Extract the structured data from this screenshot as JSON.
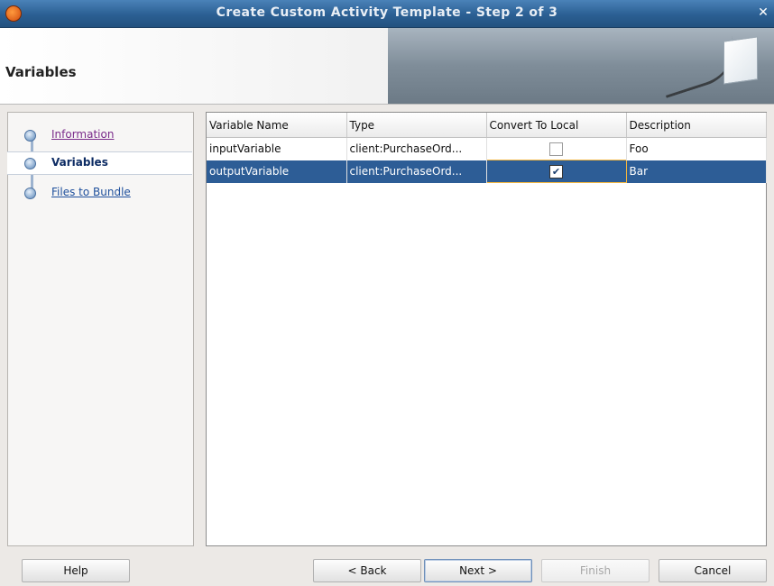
{
  "window": {
    "title": "Create Custom Activity Template - Step 2 of 3",
    "close_glyph": "✕"
  },
  "header": {
    "title": "Variables"
  },
  "nav": {
    "items": [
      {
        "label": "Information",
        "state": "visited"
      },
      {
        "label": "Variables",
        "state": "current"
      },
      {
        "label": "Files to Bundle",
        "state": "link"
      }
    ]
  },
  "table": {
    "columns": [
      "Variable Name",
      "Type",
      "Convert To Local",
      "Description"
    ],
    "rows": [
      {
        "name": "inputVariable",
        "type": "client:PurchaseOrd...",
        "convert_to_local": false,
        "description": "Foo"
      },
      {
        "name": "outputVariable",
        "type": "client:PurchaseOrd...",
        "convert_to_local": true,
        "description": "Bar"
      }
    ]
  },
  "buttons": {
    "help": "Help",
    "back": "< Back",
    "next": "Next >",
    "finish": "Finish",
    "cancel": "Cancel"
  },
  "colors": {
    "selection": "#2d5d96",
    "titlebar": "#2b5f93"
  }
}
